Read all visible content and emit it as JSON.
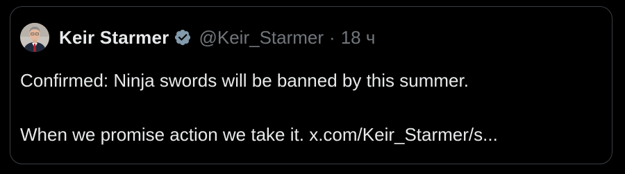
{
  "tweet": {
    "author": {
      "name": "Keir Starmer",
      "handle": "@Keir_Starmer",
      "verified_icon": "verified-badge-icon",
      "avatar_icon": "avatar-portrait"
    },
    "separator": "·",
    "time": "18 ч",
    "text_line_1": "Confirmed: Ninja swords will be banned by this summer.",
    "text_line_2_prefix": "When we promise action we take it.",
    "link": "x.com/Keir_Starmer/s..."
  },
  "colors": {
    "background": "#000000",
    "border": "#3b3f44",
    "primary_text": "#e7e9ea",
    "secondary_text": "#71767b",
    "verified_badge": "#829aab"
  }
}
